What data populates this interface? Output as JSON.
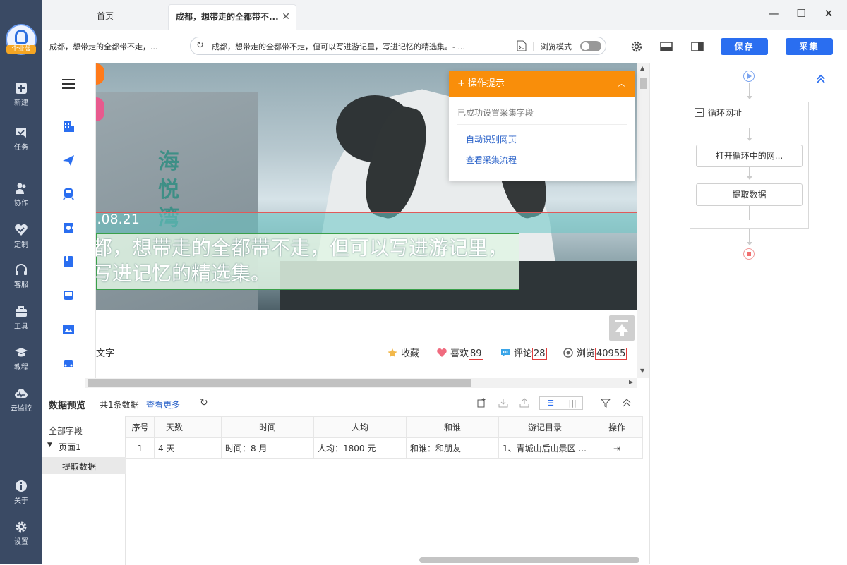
{
  "app": {
    "edition_badge": "企业版",
    "nav": [
      {
        "label": "新建",
        "icon": "plus-square-icon"
      },
      {
        "label": "任务",
        "icon": "task-icon"
      },
      {
        "label": "协作",
        "icon": "users-icon"
      },
      {
        "label": "定制",
        "icon": "heart-shield-icon"
      },
      {
        "label": "客服",
        "icon": "headset-icon"
      },
      {
        "label": "工具",
        "icon": "toolbox-icon"
      },
      {
        "label": "教程",
        "icon": "graduation-cap-icon"
      },
      {
        "label": "云监控",
        "icon": "cloud-monitor-icon"
      },
      {
        "label": "关于",
        "icon": "info-icon"
      },
      {
        "label": "设置",
        "icon": "gear-icon"
      }
    ]
  },
  "tabs": {
    "home": "首页",
    "active": "成都，想带走的全都带不..."
  },
  "toolbar": {
    "page_title": "成都，想带走的全都带不走，...",
    "url": "成都，想带走的全都带不走，但可以写进游记里，写进记忆的精选集。- ...",
    "browse_mode_label": "浏览模式",
    "save_label": "保存",
    "collect_label": "采集"
  },
  "page": {
    "hero_date": ").08.21",
    "hero_title": "都，想带走的全都带不走，但可以写进游记里，写进记忆的精选集。",
    "building_sign": "海悦湾",
    "article_text": "文字",
    "stats": [
      {
        "label": "收藏",
        "value": "",
        "icon": "star-icon",
        "color": "#f2b84b"
      },
      {
        "label": "喜欢",
        "value": "89",
        "icon": "heart-icon",
        "color": "#f06b7f"
      },
      {
        "label": "评论",
        "value": "28",
        "icon": "comment-icon",
        "color": "#3aa5e8"
      },
      {
        "label": "浏览",
        "value": "40955",
        "icon": "eye-icon",
        "color": "#666666"
      }
    ]
  },
  "tip": {
    "title": "操作提示",
    "message": "已成功设置采集字段",
    "links": [
      "自动识别网页",
      "查看采集流程"
    ]
  },
  "flow": {
    "loop_title": "循环网址",
    "steps": [
      "打开循环中的网...",
      "提取数据"
    ]
  },
  "preview": {
    "title": "数据预览",
    "count": "共1条数据",
    "more": "查看更多",
    "tree": {
      "all_fields": "全部字段",
      "page": "页面1",
      "selected": "提取数据"
    },
    "columns": [
      "序号",
      "天数",
      "时间",
      "人均",
      "和谁",
      "游记目录",
      "操作"
    ],
    "rows": [
      [
        "1",
        "4 天",
        "时间：8 月",
        "人均：1800 元",
        "和谁：和朋友",
        "1、青城山后山景区 ...",
        ""
      ]
    ]
  },
  "colors": {
    "sidebar": "#3a4a64",
    "primary": "#2a6ef0",
    "tip_header": "#f98e0a",
    "link": "#2a62c9"
  }
}
